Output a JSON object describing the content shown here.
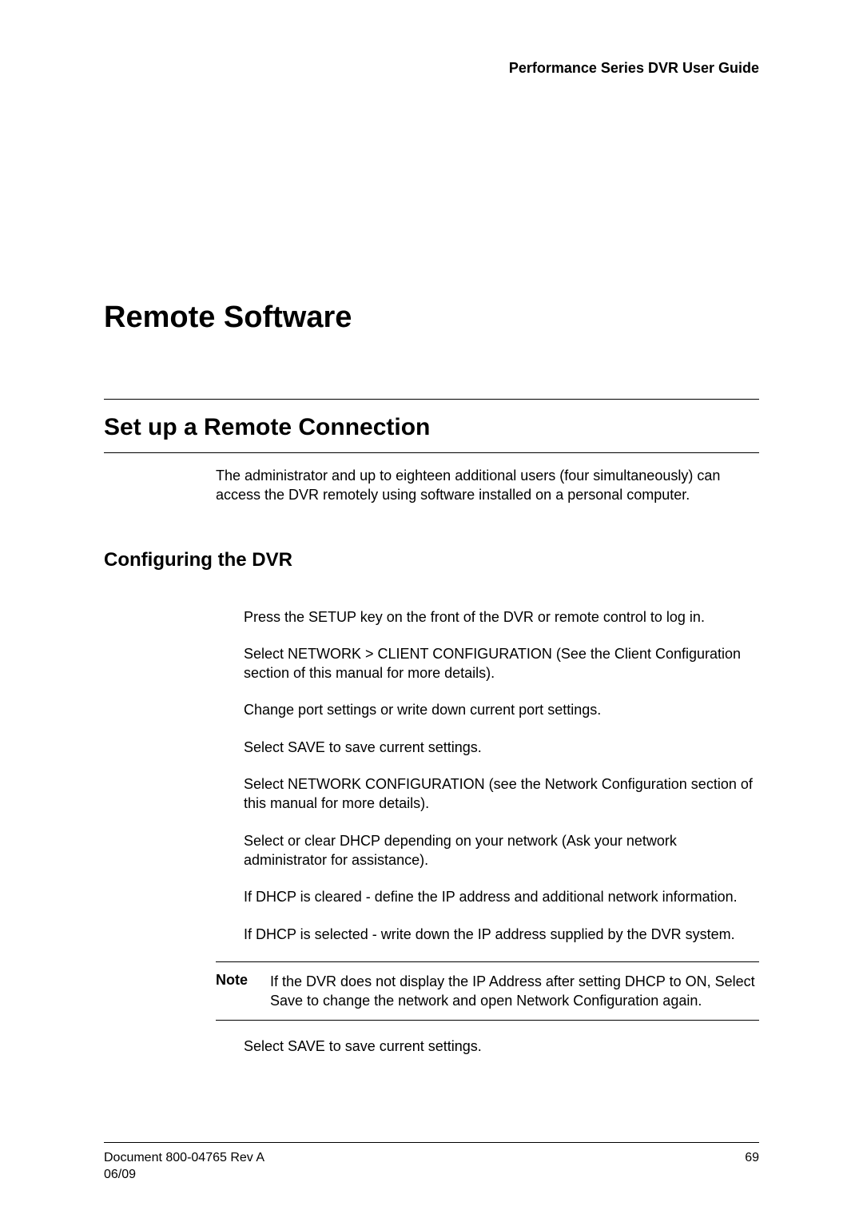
{
  "header": {
    "guide_title": "Performance Series DVR User Guide"
  },
  "chapter": {
    "title": "Remote Software"
  },
  "section": {
    "title": "Set up a Remote Connection",
    "intro": "The administrator and up to eighteen additional users (four simultaneously) can access the DVR remotely using software installed on a personal computer."
  },
  "subsection": {
    "title": "Configuring the DVR",
    "steps": [
      "Press the SETUP key on the front of the DVR or remote control to log in.",
      "Select NETWORK > CLIENT CONFIGURATION (See the Client Configuration section of this manual for more details).",
      "Change port settings or write down current port settings.",
      "Select SAVE to save current settings.",
      "Select NETWORK CONFIGURATION (see the Network Configuration section of this manual for more details).",
      "Select or clear DHCP depending on your network (Ask your network administrator for assistance).",
      "If DHCP is cleared - define the IP address and additional network information.",
      "If DHCP is selected - write down the IP address supplied by the DVR system."
    ],
    "note_label": "Note",
    "note_text": "If the DVR does not display the IP Address after setting DHCP to ON, Select Save to change the network and open Network Configuration again.",
    "after_note": "Select SAVE to save current settings."
  },
  "footer": {
    "doc_id": "Document 800-04765  Rev A",
    "date": "06/09",
    "page_number": "69"
  }
}
